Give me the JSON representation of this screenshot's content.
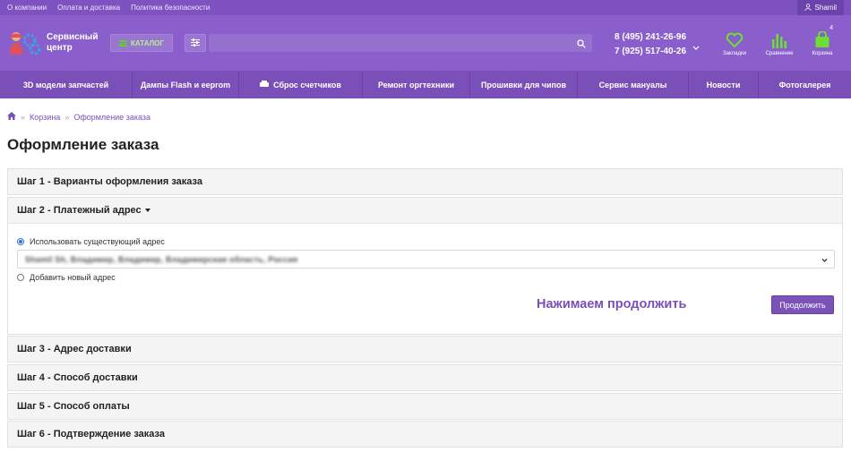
{
  "topbar": {
    "links": [
      "О компании",
      "Оплата и доставка",
      "Политика безопасности"
    ],
    "user": "Shamil"
  },
  "header": {
    "logo_text": [
      "Сервисный",
      "центр"
    ],
    "catalog_label": "КАТАЛОГ",
    "search_placeholder": "",
    "phones": [
      "8 (495) 241-26-96",
      "7 (925) 517-40-26"
    ],
    "icons": [
      {
        "name": "bookmarks",
        "label": "Закладки"
      },
      {
        "name": "compare",
        "label": "Сравнение"
      },
      {
        "name": "cart",
        "label": "Корзина",
        "count": "4"
      }
    ]
  },
  "nav": [
    "3D модели запчастей",
    "Дампы Flash и eeprom",
    "Сброс счетчиков",
    "Ремонт оргтехники",
    "Прошивки для чипов",
    "Сервис мануалы",
    "Новости",
    "Фотогалерея"
  ],
  "breadcrumb": [
    "Корзина",
    "Оформление заказа"
  ],
  "page_title": "Оформление заказа",
  "steps": [
    "Шаг 1 - Варианты оформления заказа",
    "Шаг 2 - Платежный адрес",
    "Шаг 3 - Адрес доставки",
    "Шаг 4 - Способ доставки",
    "Шаг 5 - Способ оплаты",
    "Шаг 6 - Подтверждение заказа"
  ],
  "payment": {
    "existing_label": "Использовать существующий адрес",
    "existing_address": "Shamil Sh, Владимир, Владимир, Владимирская область, Россия",
    "new_label": "Добавить новый адрес",
    "hint": "Нажимаем продолжить",
    "continue_label": "Продолжить"
  },
  "colors": {
    "brand": "#8a5fcb",
    "nav": "#7a4fb7",
    "accent_green": "#5fd02a",
    "button": "#7b52b9"
  }
}
